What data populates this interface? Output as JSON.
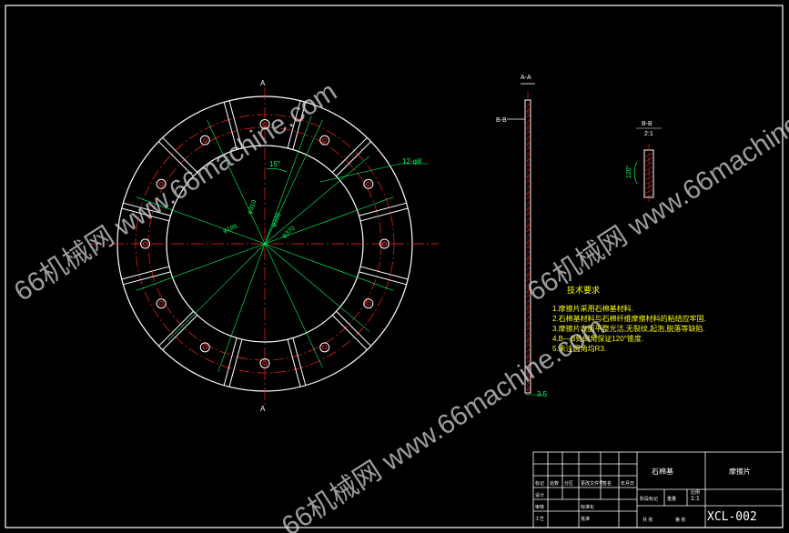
{
  "colors": {
    "background": "#000000",
    "outline": "#ffffff",
    "centerline": "#ff2020",
    "dimension": "#00ff66",
    "note": "#ffff00",
    "hatch": "#ff3030"
  },
  "main_view": {
    "section_mark_top": "A",
    "section_mark_bottom": "A",
    "dims": {
      "angle": "15°",
      "slot": "12-φ8",
      "d1": "φ310",
      "d2": "φ320",
      "d3": "φ370",
      "d4": "φ185"
    }
  },
  "section_view": {
    "title": "A-A",
    "cut_label": "B-B",
    "thickness": "3.5"
  },
  "detail_view": {
    "title": "B-B",
    "scale": "2:1",
    "angle": "120°"
  },
  "tech": {
    "heading": "技术要求",
    "items": [
      "1.摩擦片采用石棉基材料.",
      "2.石棉基材料与石棉纤维摩擦材料的粘结应牢固.",
      "3.摩擦片表面平整光洁,无裂纹,起泡,脱落等缺陷.",
      "4.B—B处倒角保证120°锥度.",
      "5.未注圆角均R3."
    ]
  },
  "title_block": {
    "material": "石棉基",
    "part_name": "摩擦片",
    "drawing_no": "XCL-002",
    "scale": "1:1",
    "cells": [
      "标记",
      "处数",
      "分区",
      "更改文件号",
      "签名",
      "年月日",
      "设计",
      "审核",
      "工艺",
      "批准",
      "标准化",
      "阶段标记",
      "重量",
      "比例",
      "共 张",
      "第 张"
    ]
  },
  "watermarks": [
    "66机械网 www.66machine.com",
    "66机械网 www.66machine.com",
    "66机械网 www.66machine.com"
  ]
}
